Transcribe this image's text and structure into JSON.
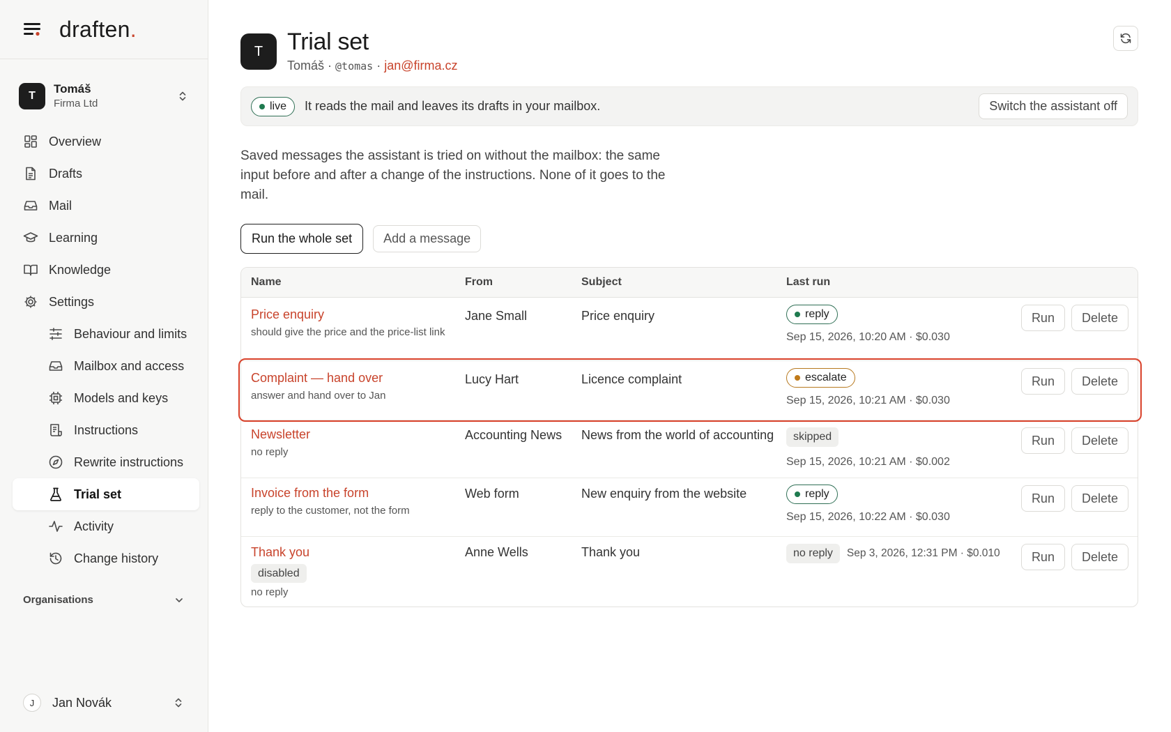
{
  "brand": {
    "name": "draften",
    "dot": "."
  },
  "account": {
    "initial": "T",
    "name": "Tomáš",
    "org": "Firma Ltd"
  },
  "nav": {
    "overview": "Overview",
    "drafts": "Drafts",
    "mail": "Mail",
    "learning": "Learning",
    "knowledge": "Knowledge",
    "settings": "Settings",
    "behaviour": "Behaviour and limits",
    "mailbox": "Mailbox and access",
    "models": "Models and keys",
    "instructions": "Instructions",
    "rewrite": "Rewrite instructions",
    "trial": "Trial set",
    "activity": "Activity",
    "history": "Change history"
  },
  "organisations_label": "Organisations",
  "user": {
    "initial": "J",
    "name": "Jan Novák"
  },
  "page": {
    "initial": "T",
    "title": "Trial set",
    "owner": "Tomáš",
    "handle": "@tomas",
    "email": "jan@firma.cz",
    "sep": " · "
  },
  "banner": {
    "status": "live",
    "text": "It reads the mail and leaves its drafts in your mailbox.",
    "switch_label": "Switch the assistant off"
  },
  "intro": "Saved messages the assistant is tried on without the mailbox: the same input before and after a change of the instructions. None of it goes to the mail.",
  "buttons": {
    "run_all": "Run the whole set",
    "add": "Add a message",
    "run": "Run",
    "delete": "Delete"
  },
  "table": {
    "headers": {
      "name": "Name",
      "from": "From",
      "subject": "Subject",
      "last_run": "Last run"
    },
    "rows": [
      {
        "name": "Price enquiry",
        "desc": "should give the price and the price-list link",
        "from": "Jane Small",
        "subject": "Price enquiry",
        "result": "reply",
        "when": "Sep 15, 2026, 10:20 AM · $0.030"
      },
      {
        "name": "Complaint — hand over",
        "desc": "answer and hand over to Jan",
        "from": "Lucy Hart",
        "subject": "Licence complaint",
        "result": "escalate",
        "when": "Sep 15, 2026, 10:21 AM · $0.030"
      },
      {
        "name": "Newsletter",
        "desc": "no reply",
        "from": "Accounting News",
        "subject": "News from the world of accounting",
        "result": "skipped",
        "when": "Sep 15, 2026, 10:21 AM · $0.002"
      },
      {
        "name": "Invoice from the form",
        "desc": "reply to the customer, not the form",
        "from": "Web form",
        "subject": "New enquiry from the website",
        "result": "reply",
        "when": "Sep 15, 2026, 10:22 AM · $0.030"
      },
      {
        "name": "Thank you",
        "tag": "disabled",
        "desc": "no reply",
        "from": "Anne Wells",
        "subject": "Thank you",
        "result": "no reply",
        "when": "Sep 3, 2026, 12:31 PM · $0.010"
      }
    ]
  },
  "colors": {
    "accent": "#c8432b",
    "live_green": "#1f7a4f",
    "escalate_orange": "#c07a1a",
    "highlight": "#d9432c"
  }
}
